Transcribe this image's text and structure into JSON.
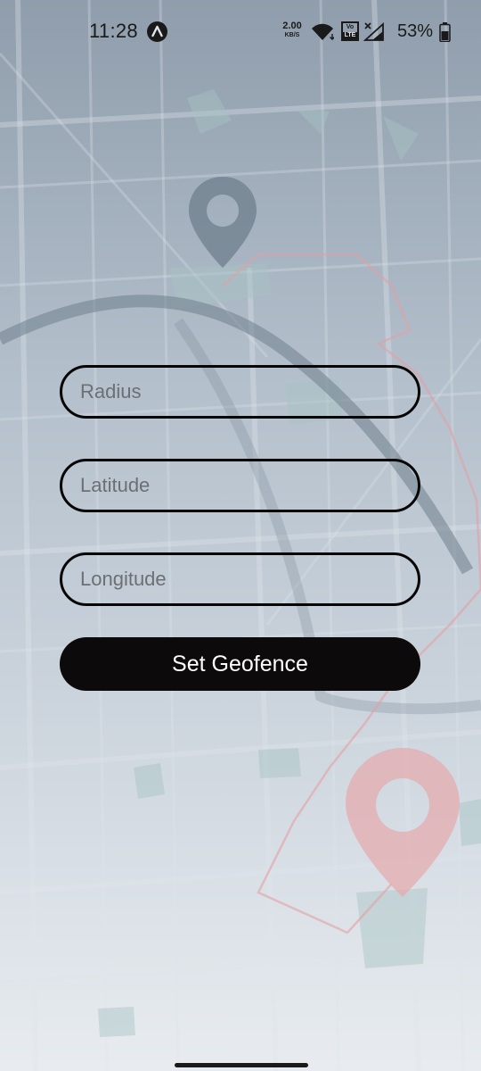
{
  "status_bar": {
    "time": "11:28",
    "net_speed_value": "2.00",
    "net_speed_unit": "KB/S",
    "volte_top": "Vo",
    "volte_bottom": "LTE",
    "battery_percent": "53%"
  },
  "form": {
    "radius": {
      "placeholder": "Radius",
      "value": ""
    },
    "latitude": {
      "placeholder": "Latitude",
      "value": ""
    },
    "longitude": {
      "placeholder": "Longitude",
      "value": ""
    },
    "submit_label": "Set Geofence"
  },
  "background": {
    "pin_top_color": "#6f7f8c",
    "pin_bottom_color": "#e6a9ad",
    "route_color": "#e2a0a4"
  },
  "icons": {
    "nav": "navigation-arrow-icon",
    "wifi": "wifi-icon",
    "signal": "cellular-signal-icon",
    "battery": "battery-icon"
  }
}
